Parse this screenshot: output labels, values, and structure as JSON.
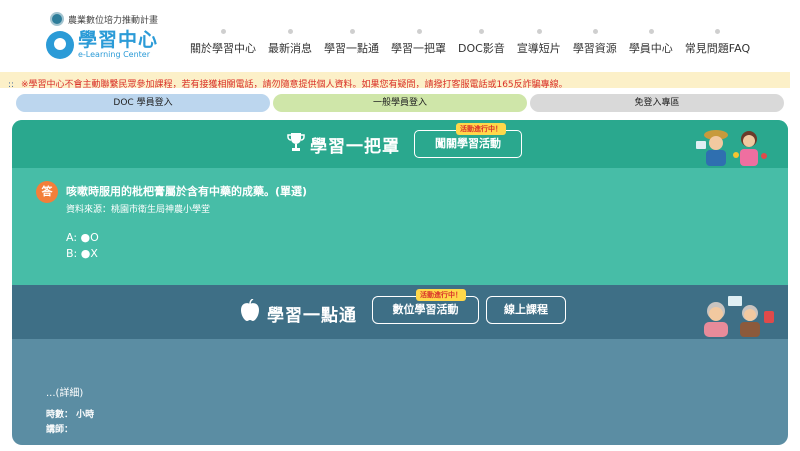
{
  "header": {
    "gov_logo_text": "農業數位培力推動計畫",
    "brand_zh": "學習中心",
    "brand_en": "e-Learning Center"
  },
  "nav": {
    "items": [
      "關於學習中心",
      "最新消息",
      "學習一點通",
      "學習一把罩",
      "DOC影音",
      "宣導短片",
      "學習資源",
      "學員中心",
      "常見問題FAQ"
    ]
  },
  "notice": {
    "prefix": ":: ",
    "text": "※學習中心不會主動聯繫民眾參加課程，若有接獲相關電話，請勿隨意提供個人資料。如果您有疑問，請撥打客服電話或165反詐騙專線。"
  },
  "login": {
    "doc": "DOC 學員登入",
    "general": "一般學員登入",
    "free": "免登入專區"
  },
  "section_quiz": {
    "title": "學習一把罩",
    "tag": "活動進行中！",
    "button": "闖關學習活動",
    "badge": "答",
    "question": "咳嗽時服用的枇杷膏屬於含有中藥的成藥。(單選)",
    "source": "資料來源：桃園市衛生局神農小學堂",
    "option_a": "A: ●O",
    "option_b": "B: ●X"
  },
  "section_course": {
    "title": "學習一點通",
    "tag": "活動進行中！",
    "button_activity": "數位學習活動",
    "button_online": "線上課程",
    "detail": "...(詳細)",
    "hours": "時數： 小時",
    "teacher": "講師："
  },
  "colors": {
    "brand_blue": "#2b9bd7",
    "quiz_green": "#47bda7",
    "quiz_head": "#2aa88e",
    "course_blue": "#5b8da3",
    "course_head": "#3e6f86",
    "badge_orange": "#f37f3a",
    "notice_red": "#d9302a"
  }
}
